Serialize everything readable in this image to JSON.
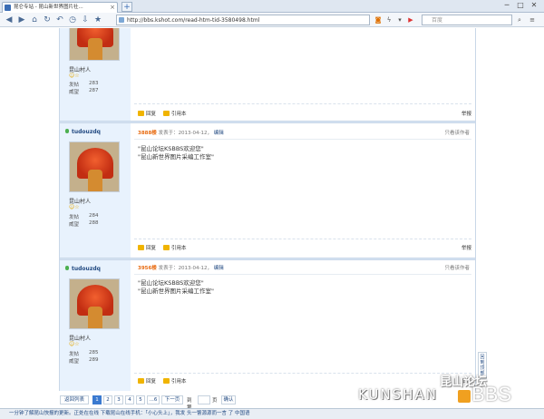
{
  "browser": {
    "tab_title": "昆仑专站 - 昆山新世界图片社...",
    "new_tab": "+",
    "url": "http://bbs.kshot.com/read-htm-tid-3580498.html",
    "search_placeholder": "百度",
    "win_min": "─",
    "win_max": "□",
    "win_close": "✕"
  },
  "posts": [
    {
      "rank": "昆山村人",
      "stars": "☺☆",
      "posts_label": "发帖",
      "posts_value": "283",
      "rep_label": "威望",
      "rep_value": "287",
      "reply": "回复",
      "quote": "引用本",
      "report": "举报"
    },
    {
      "username": "tudouzdq",
      "floor": "3888楼",
      "posted_at": "发表于：2013-04-12，",
      "edit": "编辑",
      "only_author": "只看该作者",
      "line1": "\"昆山论坛KSBBS欢迎您\"",
      "line2": "\"昆山新世界图片采编工作室\"",
      "rank": "昆山村人",
      "stars": "☺☆",
      "posts_label": "发帖",
      "posts_value": "284",
      "rep_label": "威望",
      "rep_value": "288",
      "reply": "回复",
      "quote": "引用本",
      "report": "举报"
    },
    {
      "username": "tudouzdq",
      "floor": "3956楼",
      "posted_at": "发表于：2013-04-12，",
      "edit": "编辑",
      "only_author": "只看该作者",
      "line1": "\"昆山论坛KSBBS欢迎您\"",
      "line2": "\"昆山新世界图片采编工作室\"",
      "rank": "昆山村人",
      "stars": "☺☆",
      "posts_label": "发帖",
      "posts_value": "285",
      "rep_label": "威望",
      "rep_value": "289",
      "reply": "回复",
      "quote": "引用本",
      "report": "举报"
    }
  ],
  "pager": {
    "back": "返回列表",
    "pages": [
      "1",
      "2",
      "3",
      "4",
      "5",
      "...6"
    ],
    "next": "下一页",
    "goto_label": "到第",
    "goto_unit": "页",
    "confirm": "确认"
  },
  "back_to_top": "回到顶部",
  "status_text": "一分钟了解昆山快报的更新。正处在在线 下载昆山在线手机：「小心头上」，我发 头一瞥源源而一言 了 中国语",
  "watermark": {
    "cn": "昆山论坛",
    "en": "KUNSHAN",
    "bbs": "BBS"
  }
}
